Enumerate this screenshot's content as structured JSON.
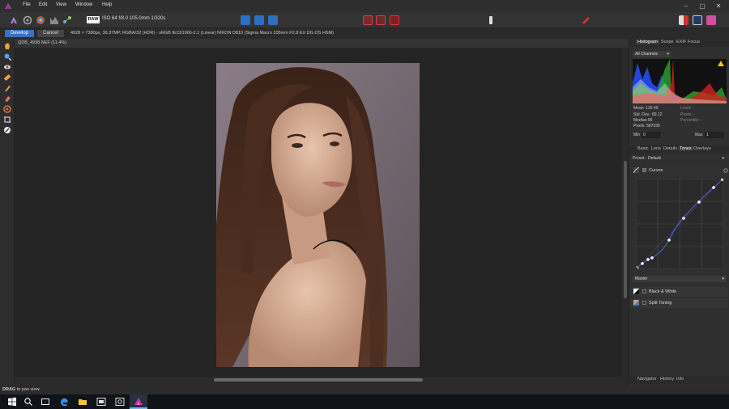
{
  "menu": {
    "items": [
      "File",
      "Edit",
      "View",
      "Window",
      "Help"
    ]
  },
  "toolbar": {
    "raw_badge": "RAW",
    "exposure_info": "ISO 64  f/8.0  105.0mm  1/320s"
  },
  "context": {
    "develop_label": "Develop",
    "cancel_label": "Cancel",
    "image_info": "4928 × 7380px, 36.37MP, RGBA/32 (HDR) - sRGB IEC61966-2.1 (Linear)",
    "camera_info": "NIKON D810 (Sigma Macro 105mm F2.8 EX DG OS HSM)"
  },
  "document": {
    "tab_title": "QDB_4938.NEF (11.4%)"
  },
  "histogram_panel": {
    "tabs": [
      "Histogram",
      "Scope",
      "EXIF",
      "Focus"
    ],
    "channel": "All Channels",
    "mean_label": "Mean:",
    "mean": "126.49",
    "stddev_label": "Std. Dev.:",
    "stddev": "89.12",
    "median_label": "Median:",
    "median": "95",
    "pixels_label": "Pixels:",
    "pixels": "587030",
    "level": "Level: -",
    "pixels_right": "Pixels: -",
    "percentile": "Percentile: -",
    "min_label": "Min",
    "min_value": "0",
    "max_label": "Max",
    "max_value": "1"
  },
  "develop_panel": {
    "tabs": [
      "Basic",
      "Lens",
      "Details",
      "Tones",
      "Overlays"
    ],
    "preset_label": "Preset:",
    "preset_value": "Default",
    "curves_label": "Curves",
    "channel_select": "Master",
    "black_white": "Black & White",
    "split_toning": "Split Toning"
  },
  "bottom_panel": {
    "tabs": [
      "Navigator",
      "History",
      "Info"
    ]
  },
  "status": {
    "hint_bold": "DRAG",
    "hint": " to pan view."
  },
  "colors": {
    "accent": "#3b6fc4",
    "panel_bg": "#2f2f2f",
    "canvas_bg": "#242424",
    "warning": "#f0c419"
  }
}
